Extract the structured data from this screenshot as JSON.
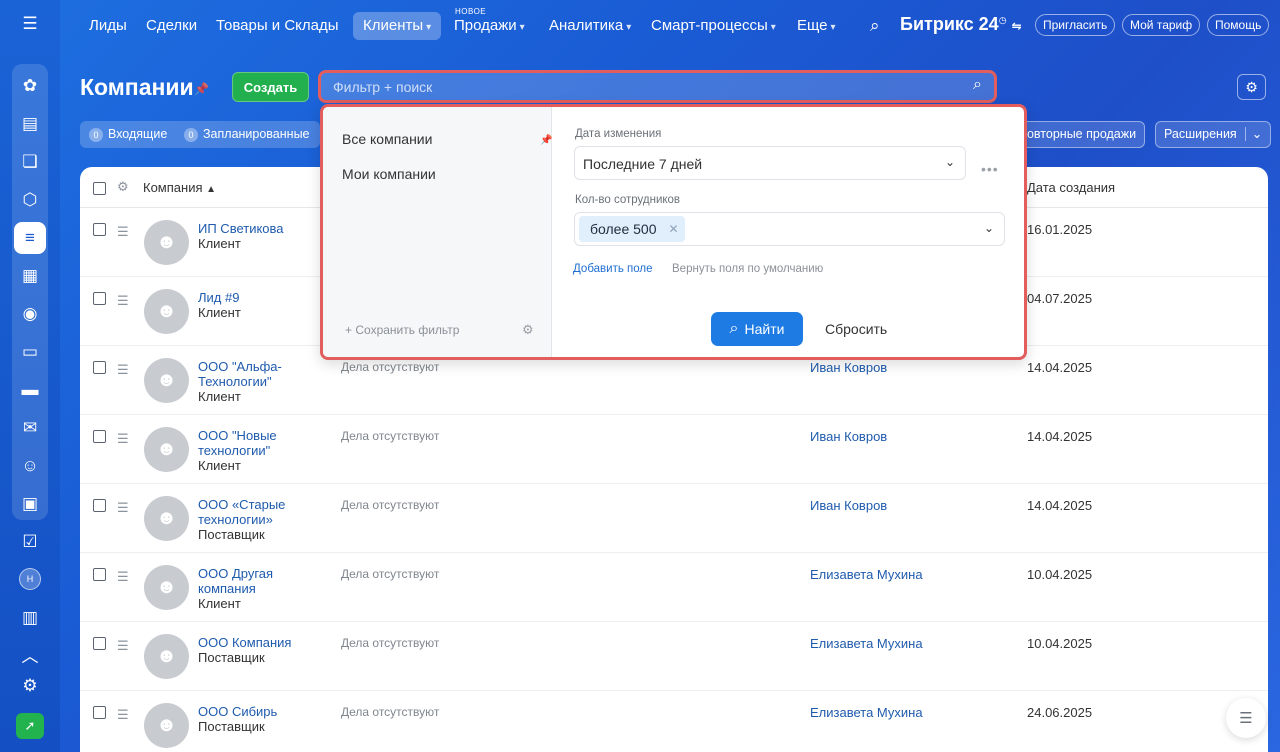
{
  "nav": {
    "items": [
      "Лиды",
      "Сделки",
      "Товары и Склады",
      "Клиенты",
      "Продажи",
      "Аналитика",
      "Смарт-процессы",
      "Еще"
    ],
    "new_badge": "НОВОЕ",
    "brand": "Битрикс 24",
    "invite": "Пригласить",
    "tariff": "Мой тариф",
    "help": "Помощь"
  },
  "sidebar": {
    "icons": [
      "chat-bubbles-icon",
      "document-icon",
      "comments-icon",
      "box-icon",
      "crm-funnel-icon",
      "calendar-icon",
      "robot-icon",
      "file-icon",
      "card-icon",
      "mail-icon",
      "users-icon",
      "board-icon",
      "checkbox-icon",
      "avatar",
      "schedule-icon",
      "chevron-up-icon",
      "gear-icon",
      "rocket-icon"
    ],
    "avatar_initial": "Н"
  },
  "page": {
    "title": "Компании",
    "create": "Создать",
    "search_placeholder": "Фильтр + поиск"
  },
  "counters": [
    {
      "count": "0",
      "label": "Входящие"
    },
    {
      "count": "0",
      "label": "Запланированные"
    }
  ],
  "toolbar": {
    "repeat_sales": "Повторные продажи",
    "extensions": "Расширения"
  },
  "table": {
    "col_company": "Компания",
    "col_created": "Дата создания",
    "rows": [
      {
        "name": "ИП Светикова",
        "type": "Клиент",
        "activities": "",
        "responsible": "",
        "date": "16.01.2025"
      },
      {
        "name": "Лид #9",
        "type": "Клиент",
        "activities": "",
        "responsible": "",
        "date": "04.07.2025"
      },
      {
        "name": "ООО \"Альфа-Технологии\"",
        "type": "Клиент",
        "activities": "Дела отсутствуют",
        "responsible": "Иван Ковров",
        "date": "14.04.2025"
      },
      {
        "name": "ООО \"Новые технологии\"",
        "type": "Клиент",
        "activities": "Дела отсутствуют",
        "responsible": "Иван Ковров",
        "date": "14.04.2025"
      },
      {
        "name": "ООО «Старые технологии»",
        "type": "Поставщик",
        "activities": "Дела отсутствуют",
        "responsible": "Иван Ковров",
        "date": "14.04.2025"
      },
      {
        "name": "ООО Другая компания",
        "type": "Клиент",
        "activities": "Дела отсутствуют",
        "responsible": "Елизавета Мухина",
        "date": "10.04.2025"
      },
      {
        "name": "ООО Компания",
        "type": "Поставщик",
        "activities": "Дела отсутствуют",
        "responsible": "Елизавета Мухина",
        "date": "10.04.2025"
      },
      {
        "name": "ООО Сибирь",
        "type": "Поставщик",
        "activities": "Дела отсутствуют",
        "responsible": "Елизавета Мухина",
        "date": "24.06.2025"
      }
    ]
  },
  "filter": {
    "presets": [
      "Все компании",
      "Мои компании"
    ],
    "save_filter": "Сохранить фильтр",
    "fields": {
      "modified_label": "Дата изменения",
      "modified_value": "Последние 7 дней",
      "employees_label": "Кол-во сотрудников",
      "employees_chip": "более 500"
    },
    "add_field": "Добавить поле",
    "restore_fields": "Вернуть поля по умолчанию",
    "find": "Найти",
    "reset": "Сбросить"
  },
  "colors": {
    "accent": "#1e7be4",
    "create_green": "#22b04e",
    "highlight_red": "#e25d5d",
    "link_blue": "#1f5bad"
  }
}
